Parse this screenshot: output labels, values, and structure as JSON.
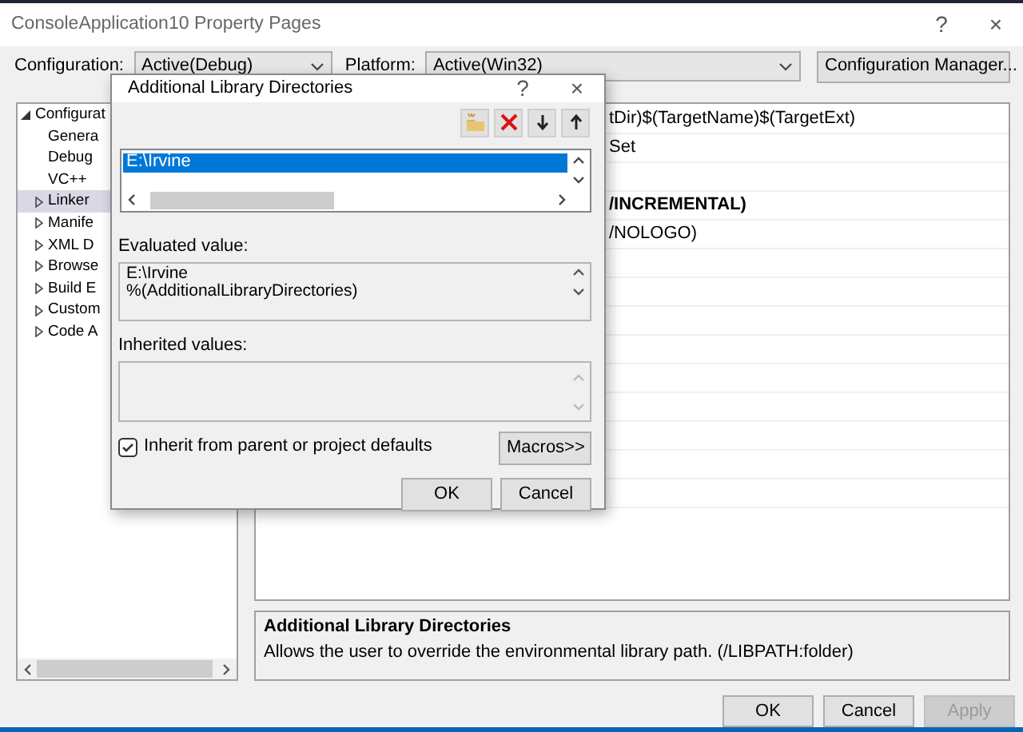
{
  "window": {
    "title": "ConsoleApplication10 Property Pages",
    "help": "?",
    "close": "×"
  },
  "config_bar": {
    "configuration_label": "Configuration:",
    "configuration_value": "Active(Debug)",
    "platform_label": "Platform:",
    "platform_value": "Active(Win32)",
    "manager_button": "Configuration Manager..."
  },
  "tree": {
    "items": [
      {
        "label": "Configurat",
        "expanded": true,
        "selected": false,
        "children": [
          {
            "label": "Genera",
            "selected": false
          },
          {
            "label": "Debug",
            "selected": false
          },
          {
            "label": "VC++",
            "selected": false
          },
          {
            "label": "Linker",
            "expanded": false,
            "selected": true
          },
          {
            "label": "Manife",
            "expanded": false,
            "selected": false
          },
          {
            "label": "XML D",
            "expanded": false,
            "selected": false
          },
          {
            "label": "Browse",
            "expanded": false,
            "selected": false
          },
          {
            "label": "Build E",
            "expanded": false,
            "selected": false
          },
          {
            "label": "Custom",
            "expanded": false,
            "selected": false
          },
          {
            "label": "Code A",
            "expanded": false,
            "selected": false
          }
        ]
      }
    ]
  },
  "property_grid": {
    "rows": [
      {
        "kind": "value",
        "value": "tDir)$(TargetName)$(TargetExt)",
        "bold": false
      },
      {
        "kind": "value",
        "value": "Set",
        "bold": false
      },
      {
        "kind": "blank"
      },
      {
        "kind": "value",
        "value": "/INCREMENTAL)",
        "bold": true
      },
      {
        "kind": "value",
        "value": "/NOLOGO)",
        "bold": false
      }
    ]
  },
  "description": {
    "title": "Additional Library Directories",
    "text": "Allows the user to override the environmental library path. (/LIBPATH:folder)"
  },
  "buttons": [
    {
      "label": "OK",
      "disabled": false
    },
    {
      "label": "Cancel",
      "disabled": false
    },
    {
      "label": "Apply",
      "disabled": true
    }
  ],
  "dialog": {
    "title": "Additional Library Directories",
    "help": "?",
    "close": "×",
    "toolbar": [
      {
        "kind": "folder"
      },
      {
        "kind": "delete"
      },
      {
        "kind": "down"
      },
      {
        "kind": "up"
      }
    ],
    "entries": [
      {
        "text": "E:\\Irvine",
        "selected": true
      }
    ],
    "evaluated_label": "Evaluated value:",
    "evaluated_lines": [
      "E:\\Irvine",
      "%(AdditionalLibraryDirectories)"
    ],
    "inherited_label": "Inherited values:",
    "inherit_checkbox": {
      "label": "Inherit from parent or project defaults",
      "checked": true
    },
    "macros_button": "Macros>>",
    "buttons": [
      "OK",
      "Cancel"
    ]
  }
}
